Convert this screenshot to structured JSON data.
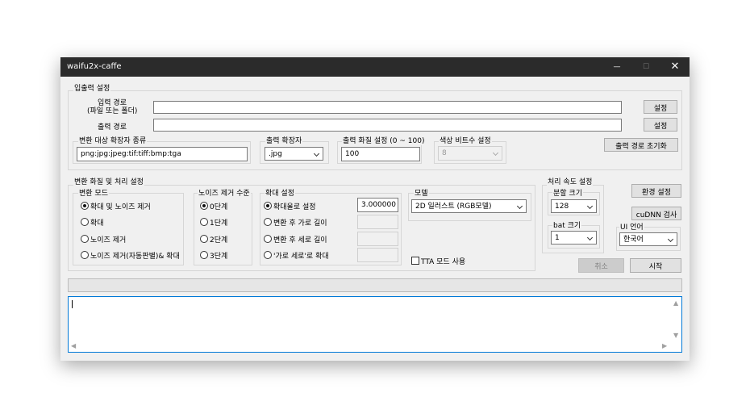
{
  "window": {
    "title": "waifu2x-caffe"
  },
  "io": {
    "group_label": "입출력 설정",
    "input_label_1": "입력 경로",
    "input_label_2": "(파일 또는 폴더)",
    "input_value": "",
    "input_button": "설정",
    "output_label": "출력 경로",
    "output_value": "",
    "output_button": "설정",
    "ext_label": "변환 대상 확장자 종류",
    "ext_value": "png:jpg:jpeg:tif:tiff:bmp:tga",
    "out_ext_label": "출력 확장자",
    "out_ext_value": ".jpg",
    "quality_label": "출력 화질 설정 (0 ~ 100)",
    "quality_value": "100",
    "bit_label": "색상 비트수 설정",
    "bit_value": "8",
    "reset_button": "출력 경로 초기화"
  },
  "conv": {
    "group_label": "변환 화질 및 처리 설정",
    "mode_label": "변환 모드",
    "modes": [
      "확대 및 노이즈 제거",
      "확대",
      "노이즈 제거",
      "노이즈 제거(자동판별)& 확대"
    ],
    "noise_label": "노이즈 제거 수준",
    "noise_levels": [
      "0단계",
      "1단계",
      "2단계",
      "3단계"
    ],
    "scale_label": "확대 설정",
    "scale_options": [
      "확대율로 설정",
      "변환 후 가로 길이",
      "변환 후 세로 길이",
      "'가로 세로'로 확대"
    ],
    "scale_ratio": "3.000000",
    "model_label": "모델",
    "model_value": "2D 일러스트 (RGB모델)",
    "tta_label": "TTA 모드 사용"
  },
  "speed": {
    "group_label": "처리 속도 설정",
    "split_label": "분할 크기",
    "split_value": "128",
    "batch_label": "bat 크기",
    "batch_value": "1"
  },
  "side": {
    "env_button": "환경 설정",
    "cudnn_button": "cuDNN 검사",
    "lang_label": "UI 언어",
    "lang_value": "한국어"
  },
  "actions": {
    "cancel": "취소",
    "start": "시작"
  },
  "log": {
    "text": ""
  }
}
